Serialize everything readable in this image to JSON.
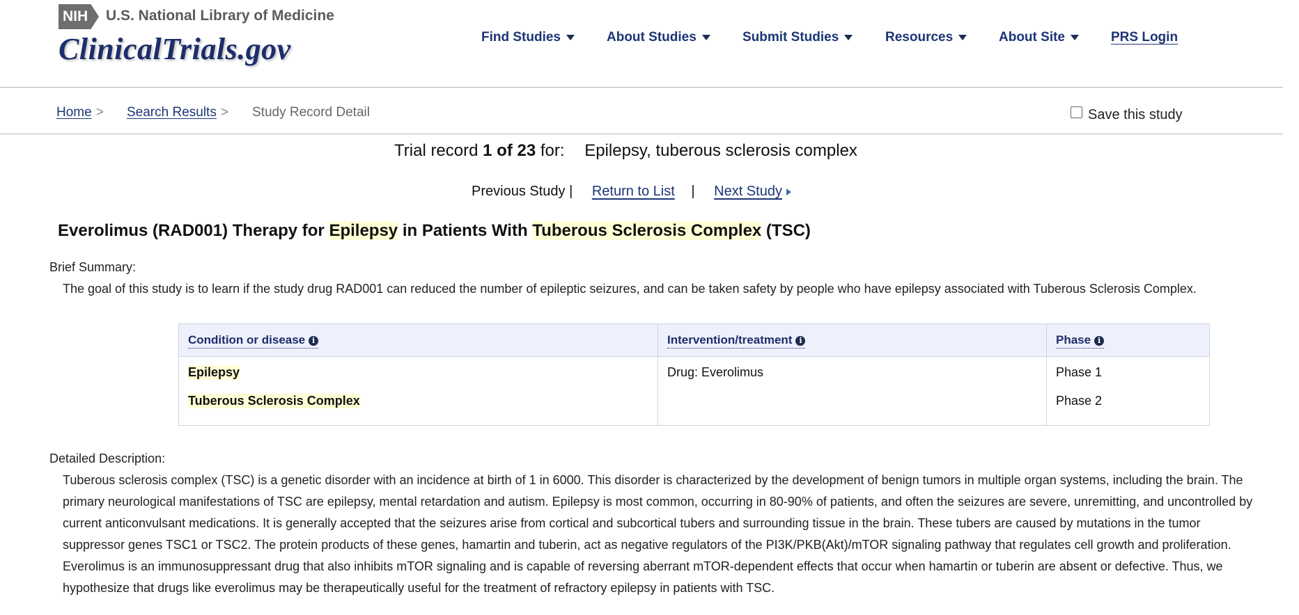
{
  "header": {
    "nih_badge": "NIH",
    "nih_name": "U.S. National Library of Medicine",
    "logo": "ClinicalTrials.gov",
    "nav": [
      {
        "label": "Find Studies",
        "has_menu": true
      },
      {
        "label": "About Studies",
        "has_menu": true
      },
      {
        "label": "Submit Studies",
        "has_menu": true
      },
      {
        "label": "Resources",
        "has_menu": true
      },
      {
        "label": "About Site",
        "has_menu": true
      }
    ],
    "prs_login": "PRS Login"
  },
  "breadcrumb": {
    "home": "Home",
    "search_results": "Search Results",
    "current": "Study Record Detail",
    "separator": ">"
  },
  "save_study": {
    "label": "Save this study",
    "checked": false
  },
  "trial_record": {
    "prefix": "Trial record",
    "position": "1 of 23",
    "for_label": "for:",
    "query": "Epilepsy, tuberous sclerosis complex"
  },
  "study_nav": {
    "previous": "Previous Study",
    "pipe": "|",
    "return": "Return to List",
    "next": "Next Study"
  },
  "study": {
    "title_parts": {
      "a": "Everolimus (RAD001) Therapy for ",
      "b": "Epilepsy",
      "c": " in Patients With ",
      "d": "Tuberous Sclerosis Complex",
      "e": " (TSC)"
    },
    "brief_summary_label": "Brief Summary:",
    "brief_summary": "The goal of this study is to learn if the study drug RAD001 can reduced the number of epileptic seizures, and can be taken safety by people who have epilepsy associated with Tuberous Sclerosis Complex.",
    "table": {
      "headers": [
        "Condition or disease",
        "Intervention/treatment",
        "Phase"
      ],
      "conditions": [
        "Epilepsy",
        "Tuberous Sclerosis Complex"
      ],
      "interventions": [
        "Drug: Everolimus"
      ],
      "phases": [
        "Phase 1",
        "Phase 2"
      ]
    },
    "detailed_description_label": "Detailed Description:",
    "detailed_description_lines": [
      "Tuberous sclerosis complex (TSC) is a genetic disorder with an incidence at birth of 1 in 6000. This disorder is characterized by the development of benign tumors in multiple organ systems, including the brain. The",
      "primary neurological manifestations of TSC are epilepsy, mental retardation and autism. Epilepsy is most common, occurring in 80-90% of patients, and often the seizures are severe, unremitting, and uncontrolled by",
      "current anticonvulsant medications. It is generally accepted that the seizures arise from cortical and subcortical tubers and surrounding tissue in the brain. These tubers are caused by mutations in the tumor",
      "suppressor genes TSC1 or TSC2. The protein products of these genes, hamartin and tuberin, act as negative regulators of the PI3K/PKB(Akt)/mTOR signaling pathway that regulates cell growth and proliferation.",
      "Everolimus is an immunosuppressant drug that also inhibits mTOR signaling and is capable of reversing aberrant mTOR-dependent effects that occur when hamartin or tuberin are absent or defective. Thus, we",
      "hypothesize that drugs like everolimus may be therapeutically useful for the treatment of refractory epilepsy in patients with TSC."
    ]
  }
}
